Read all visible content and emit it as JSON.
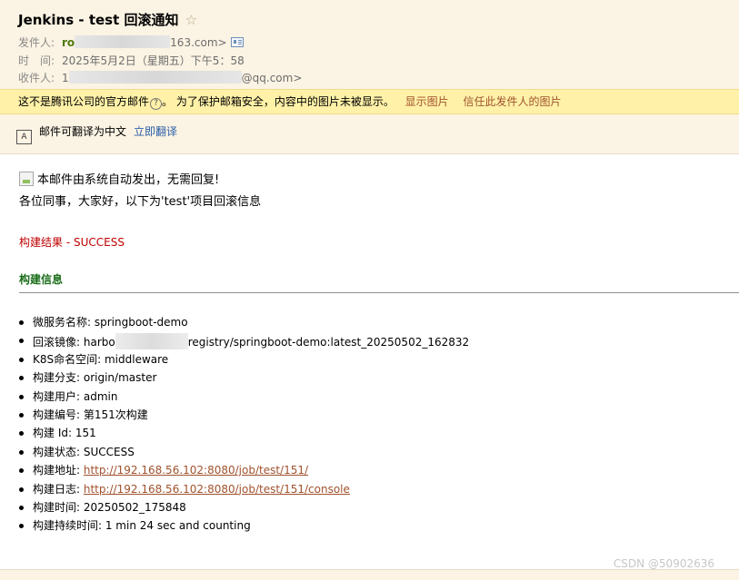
{
  "header": {
    "subject": "Jenkins - test 回滚通知",
    "star_icon": "star-outline-icon",
    "from_label": "发件人:",
    "from_name_prefix": "ro",
    "from_domain": "163.com>",
    "time_label": "时　间:",
    "time_value": "2025年5月2日（星期五）下午5：58",
    "to_label": "收件人:",
    "to_prefix": "1",
    "to_domain": "@qq.com>"
  },
  "warning_bar": {
    "text": "这不是腾讯公司的官方邮件",
    "text2": "。 为了保护邮箱安全，内容中的图片未被显示。",
    "show_images": "显示图片",
    "trust_sender": "信任此发件人的图片"
  },
  "translate": {
    "text": "邮件可翻译为中文",
    "link": "立即翻译"
  },
  "body": {
    "notice": "本邮件由系统自动发出，无需回复!",
    "greeting": "各位同事，大家好，以下为'test'项目回滚信息",
    "result": "构建结果 - SUCCESS",
    "info_title": "构建信息",
    "items": [
      {
        "label": "微服务名称: ",
        "value": "springboot-demo"
      },
      {
        "label": "回滚镜像: ",
        "value_prefix": "harbo",
        "value_suffix": "registry/springboot-demo:latest_20250502_162832"
      },
      {
        "label": "K8S命名空间: ",
        "value": "middleware"
      },
      {
        "label": "构建分支: ",
        "value": "origin/master"
      },
      {
        "label": "构建用户: ",
        "value": "admin"
      },
      {
        "label": "构建编号: ",
        "value": "第151次构建"
      },
      {
        "label": "构建 Id: ",
        "value": "151"
      },
      {
        "label": "构建状态: ",
        "value": "SUCCESS"
      },
      {
        "label": "构建地址: ",
        "link": "http://192.168.56.102:8080/job/test/151/"
      },
      {
        "label": "构建日志: ",
        "link": "http://192.168.56.102:8080/job/test/151/console"
      },
      {
        "label": "构建时间: ",
        "value": "20250502_175848"
      },
      {
        "label": "构建持续时间: ",
        "value": "1 min 24 sec and counting"
      }
    ]
  },
  "watermark": "CSDN @50902636",
  "colors": {
    "header_bg": "#fbf3e3",
    "warn_bg": "#fff1a8",
    "link": "#a0522d",
    "translate_link": "#2a5ea8",
    "result_red": "#c00000",
    "info_green": "#1a6e1a"
  }
}
